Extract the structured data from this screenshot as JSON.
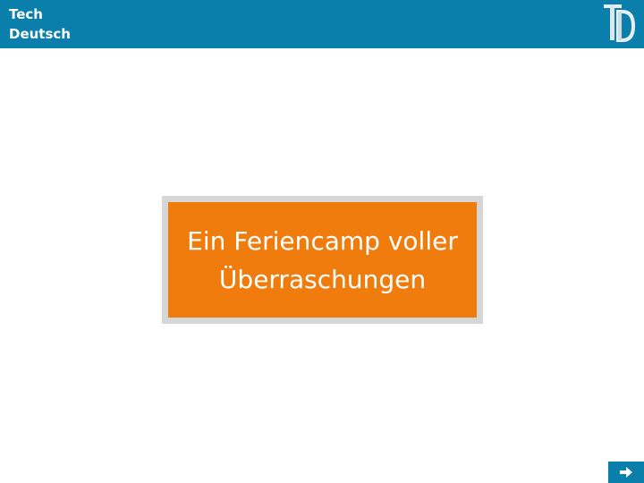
{
  "header": {
    "brand_line1": "Tech",
    "brand_line2": "Deutsch",
    "logo_icon": "td-logo-icon",
    "background_color": "#0b7fab"
  },
  "main": {
    "title_line1": "Ein Feriencamp voller",
    "title_line2": "Überraschungen",
    "title_background_color": "#f07c0d",
    "title_frame_color": "#d6d6d6"
  },
  "navigation": {
    "next_icon": "arrow-right-icon"
  }
}
